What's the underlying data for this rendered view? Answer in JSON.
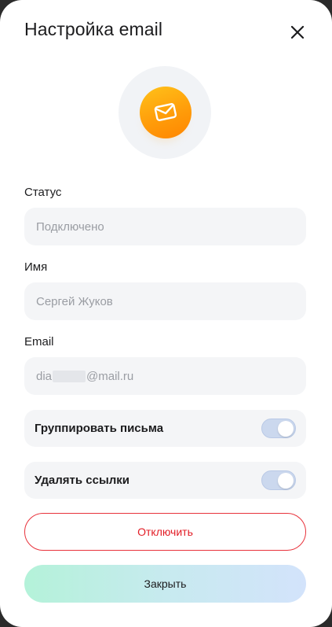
{
  "dialog": {
    "title": "Настройка email",
    "close_icon": "close-icon",
    "hero_icon": "mail-envelope-icon"
  },
  "fields": {
    "status": {
      "label": "Статус",
      "value": "Подключено"
    },
    "name": {
      "label": "Имя",
      "value": "Сергей Жуков"
    },
    "email": {
      "label": "Email",
      "value_prefix": "dia",
      "value_suffix": "@mail.ru",
      "masked": true
    }
  },
  "toggles": {
    "group_letters": {
      "label": "Группировать письма",
      "enabled": true
    },
    "delete_links": {
      "label": "Удалять ссылки",
      "enabled": true
    }
  },
  "buttons": {
    "disconnect": "Отключить",
    "close": "Закрыть"
  },
  "colors": {
    "accent_orange": "#ff9d0a",
    "danger": "#e21c25",
    "field_bg": "#f4f5f7",
    "toggle_on": "#cbd8ee"
  }
}
